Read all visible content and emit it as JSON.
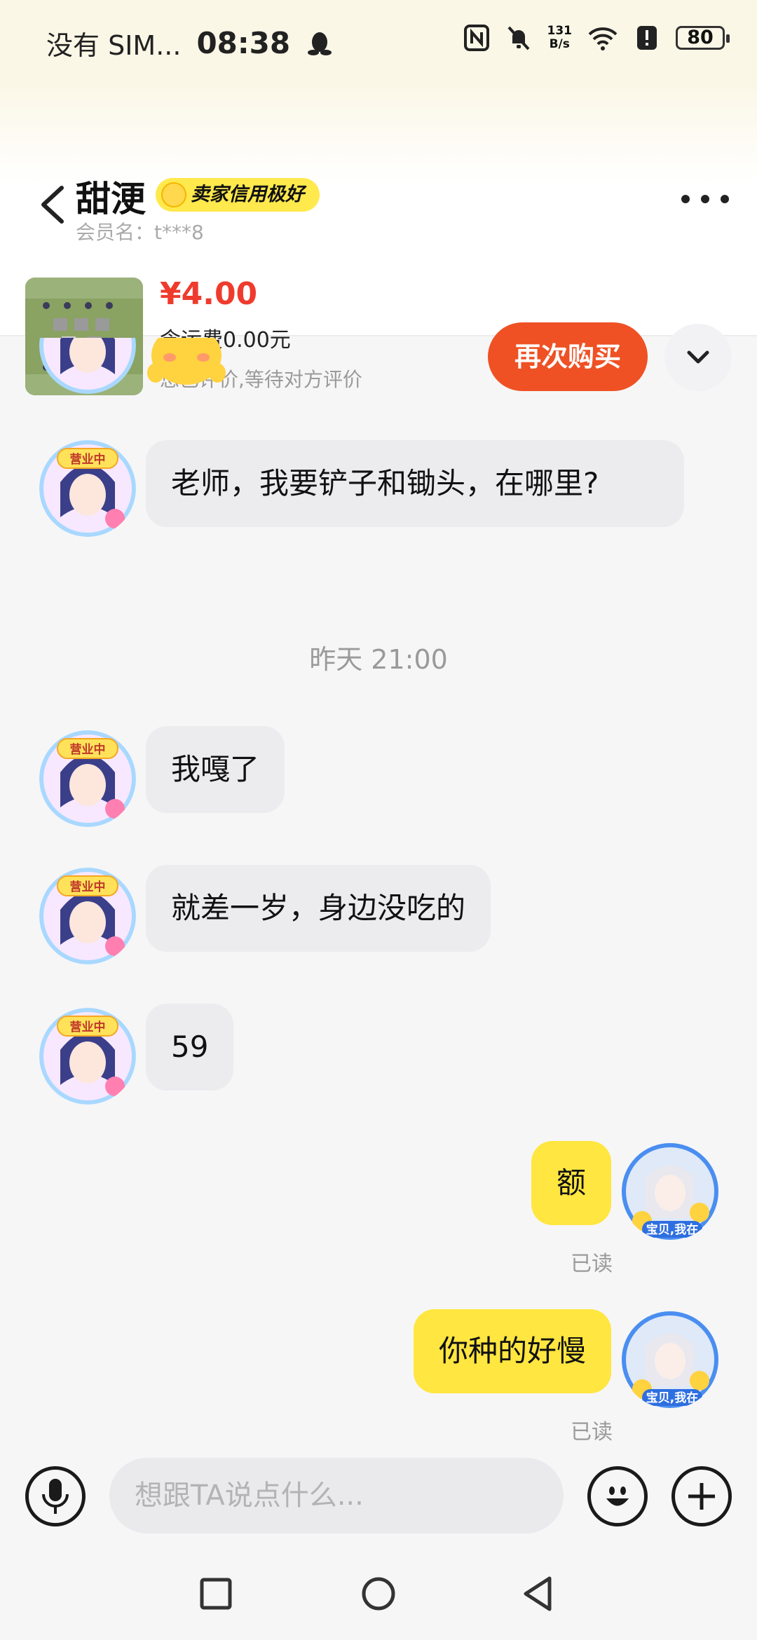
{
  "status_bar": {
    "carrier": "没有 SIM...",
    "time": "08:38",
    "net_speed_value": "131",
    "net_speed_unit": "B/s",
    "battery": "80"
  },
  "header": {
    "shop_name": "甜浭",
    "credit_badge": "卖家信用极好",
    "member_label": "会员名：t***8"
  },
  "order": {
    "price": "¥4.00",
    "shipping": "含运费0.00元",
    "review_status": "您已评价,等待对方评价",
    "rebuy_label": "再次购买"
  },
  "chat": {
    "messages_left": [
      "老师，我要铲子和锄头，在哪里?",
      "我嘎了",
      "就差一岁，身边没吃的",
      "59"
    ],
    "time_divider": "昨天 21:00",
    "messages_right": [
      "额",
      "你种的好慢"
    ],
    "read_status": "已读",
    "avatar_tag_left": "营业中",
    "avatar_tag_right": "宝贝,我在"
  },
  "input": {
    "placeholder": "想跟TA说点什么..."
  },
  "colors": {
    "accent_yellow": "#ffe640",
    "rebuy_orange": "#ef5124",
    "price_red": "#ef3b2d"
  }
}
